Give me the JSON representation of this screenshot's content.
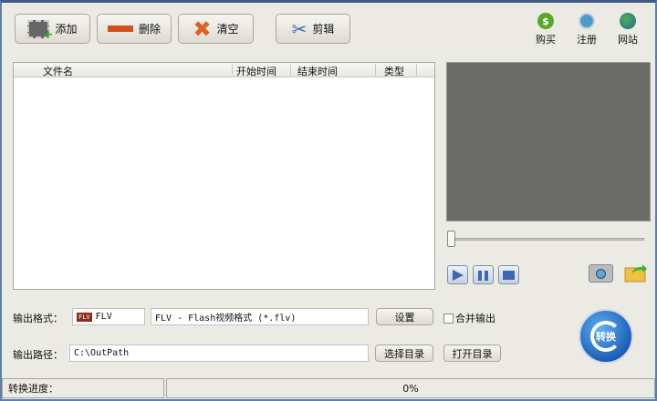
{
  "toolbar": {
    "add": "添加",
    "delete": "删除",
    "clear": "清空",
    "cut": "剪辑"
  },
  "top_links": {
    "buy": "购买",
    "register": "注册",
    "website": "网站"
  },
  "file_list": {
    "columns": [
      "文件名",
      "开始时间",
      "结束时间",
      "类型"
    ],
    "rows": []
  },
  "output": {
    "format_label": "输出格式：",
    "format_short": "FLV",
    "format_icon_text": "FLV",
    "format_full": "FLV - Flash视频格式 (*.flv)",
    "settings": "设置",
    "merge_label": "合并输出",
    "merge_checked": false,
    "path_label": "输出路径：",
    "path_value": "C:\\OutPath",
    "choose_dir": "选择目录",
    "open_dir": "打开目录"
  },
  "convert_button": "转换",
  "status": {
    "label": "转换进度：",
    "progress_text": "0%",
    "progress": 0
  },
  "player": {
    "position": 0
  }
}
